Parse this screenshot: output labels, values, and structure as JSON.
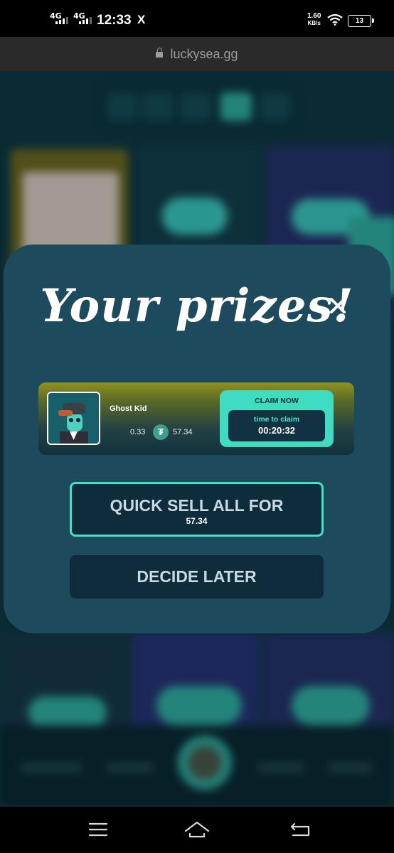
{
  "status_bar": {
    "network1": "4G",
    "network2": "4G",
    "time": "12:33",
    "x_logo": "X",
    "speed_value": "1.60",
    "speed_unit": "KB/s",
    "battery": "13"
  },
  "browser": {
    "url": "luckysea.gg"
  },
  "modal": {
    "title": "Your prizes!",
    "close_icon": "close-icon",
    "prize": {
      "name": "Ghost Kid",
      "odds": "0.33",
      "price": "57.34",
      "currency_icon": "tether-coin-icon",
      "claim_label": "CLAIM NOW",
      "time_label": "time to claim",
      "time_value": "00:20:32"
    },
    "quick_sell_label": "QUICK SELL ALL FOR",
    "quick_sell_value": "57.34",
    "decide_later_label": "DECIDE LATER"
  },
  "colors": {
    "modal_bg": "#1d4a5c",
    "accent": "#40dcc2",
    "button_bg": "#0f2c3d"
  },
  "nav_bar": {
    "icons": [
      "menu-icon",
      "home-icon",
      "back-icon"
    ]
  }
}
